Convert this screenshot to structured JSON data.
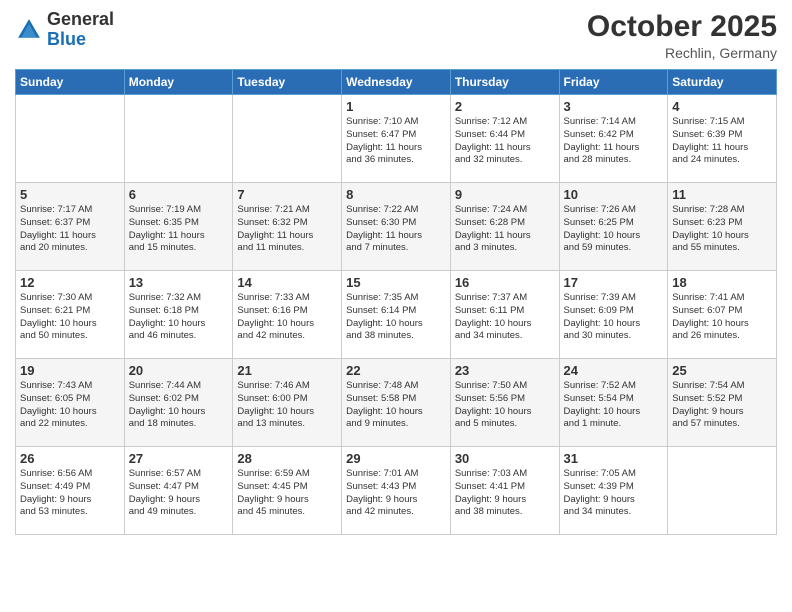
{
  "header": {
    "logo_general": "General",
    "logo_blue": "Blue",
    "month_year": "October 2025",
    "location": "Rechlin, Germany"
  },
  "columns": [
    "Sunday",
    "Monday",
    "Tuesday",
    "Wednesday",
    "Thursday",
    "Friday",
    "Saturday"
  ],
  "weeks": [
    [
      {
        "day": "",
        "info": ""
      },
      {
        "day": "",
        "info": ""
      },
      {
        "day": "",
        "info": ""
      },
      {
        "day": "1",
        "info": "Sunrise: 7:10 AM\nSunset: 6:47 PM\nDaylight: 11 hours\nand 36 minutes."
      },
      {
        "day": "2",
        "info": "Sunrise: 7:12 AM\nSunset: 6:44 PM\nDaylight: 11 hours\nand 32 minutes."
      },
      {
        "day": "3",
        "info": "Sunrise: 7:14 AM\nSunset: 6:42 PM\nDaylight: 11 hours\nand 28 minutes."
      },
      {
        "day": "4",
        "info": "Sunrise: 7:15 AM\nSunset: 6:39 PM\nDaylight: 11 hours\nand 24 minutes."
      }
    ],
    [
      {
        "day": "5",
        "info": "Sunrise: 7:17 AM\nSunset: 6:37 PM\nDaylight: 11 hours\nand 20 minutes."
      },
      {
        "day": "6",
        "info": "Sunrise: 7:19 AM\nSunset: 6:35 PM\nDaylight: 11 hours\nand 15 minutes."
      },
      {
        "day": "7",
        "info": "Sunrise: 7:21 AM\nSunset: 6:32 PM\nDaylight: 11 hours\nand 11 minutes."
      },
      {
        "day": "8",
        "info": "Sunrise: 7:22 AM\nSunset: 6:30 PM\nDaylight: 11 hours\nand 7 minutes."
      },
      {
        "day": "9",
        "info": "Sunrise: 7:24 AM\nSunset: 6:28 PM\nDaylight: 11 hours\nand 3 minutes."
      },
      {
        "day": "10",
        "info": "Sunrise: 7:26 AM\nSunset: 6:25 PM\nDaylight: 10 hours\nand 59 minutes."
      },
      {
        "day": "11",
        "info": "Sunrise: 7:28 AM\nSunset: 6:23 PM\nDaylight: 10 hours\nand 55 minutes."
      }
    ],
    [
      {
        "day": "12",
        "info": "Sunrise: 7:30 AM\nSunset: 6:21 PM\nDaylight: 10 hours\nand 50 minutes."
      },
      {
        "day": "13",
        "info": "Sunrise: 7:32 AM\nSunset: 6:18 PM\nDaylight: 10 hours\nand 46 minutes."
      },
      {
        "day": "14",
        "info": "Sunrise: 7:33 AM\nSunset: 6:16 PM\nDaylight: 10 hours\nand 42 minutes."
      },
      {
        "day": "15",
        "info": "Sunrise: 7:35 AM\nSunset: 6:14 PM\nDaylight: 10 hours\nand 38 minutes."
      },
      {
        "day": "16",
        "info": "Sunrise: 7:37 AM\nSunset: 6:11 PM\nDaylight: 10 hours\nand 34 minutes."
      },
      {
        "day": "17",
        "info": "Sunrise: 7:39 AM\nSunset: 6:09 PM\nDaylight: 10 hours\nand 30 minutes."
      },
      {
        "day": "18",
        "info": "Sunrise: 7:41 AM\nSunset: 6:07 PM\nDaylight: 10 hours\nand 26 minutes."
      }
    ],
    [
      {
        "day": "19",
        "info": "Sunrise: 7:43 AM\nSunset: 6:05 PM\nDaylight: 10 hours\nand 22 minutes."
      },
      {
        "day": "20",
        "info": "Sunrise: 7:44 AM\nSunset: 6:02 PM\nDaylight: 10 hours\nand 18 minutes."
      },
      {
        "day": "21",
        "info": "Sunrise: 7:46 AM\nSunset: 6:00 PM\nDaylight: 10 hours\nand 13 minutes."
      },
      {
        "day": "22",
        "info": "Sunrise: 7:48 AM\nSunset: 5:58 PM\nDaylight: 10 hours\nand 9 minutes."
      },
      {
        "day": "23",
        "info": "Sunrise: 7:50 AM\nSunset: 5:56 PM\nDaylight: 10 hours\nand 5 minutes."
      },
      {
        "day": "24",
        "info": "Sunrise: 7:52 AM\nSunset: 5:54 PM\nDaylight: 10 hours\nand 1 minute."
      },
      {
        "day": "25",
        "info": "Sunrise: 7:54 AM\nSunset: 5:52 PM\nDaylight: 9 hours\nand 57 minutes."
      }
    ],
    [
      {
        "day": "26",
        "info": "Sunrise: 6:56 AM\nSunset: 4:49 PM\nDaylight: 9 hours\nand 53 minutes."
      },
      {
        "day": "27",
        "info": "Sunrise: 6:57 AM\nSunset: 4:47 PM\nDaylight: 9 hours\nand 49 minutes."
      },
      {
        "day": "28",
        "info": "Sunrise: 6:59 AM\nSunset: 4:45 PM\nDaylight: 9 hours\nand 45 minutes."
      },
      {
        "day": "29",
        "info": "Sunrise: 7:01 AM\nSunset: 4:43 PM\nDaylight: 9 hours\nand 42 minutes."
      },
      {
        "day": "30",
        "info": "Sunrise: 7:03 AM\nSunset: 4:41 PM\nDaylight: 9 hours\nand 38 minutes."
      },
      {
        "day": "31",
        "info": "Sunrise: 7:05 AM\nSunset: 4:39 PM\nDaylight: 9 hours\nand 34 minutes."
      },
      {
        "day": "",
        "info": ""
      }
    ]
  ]
}
